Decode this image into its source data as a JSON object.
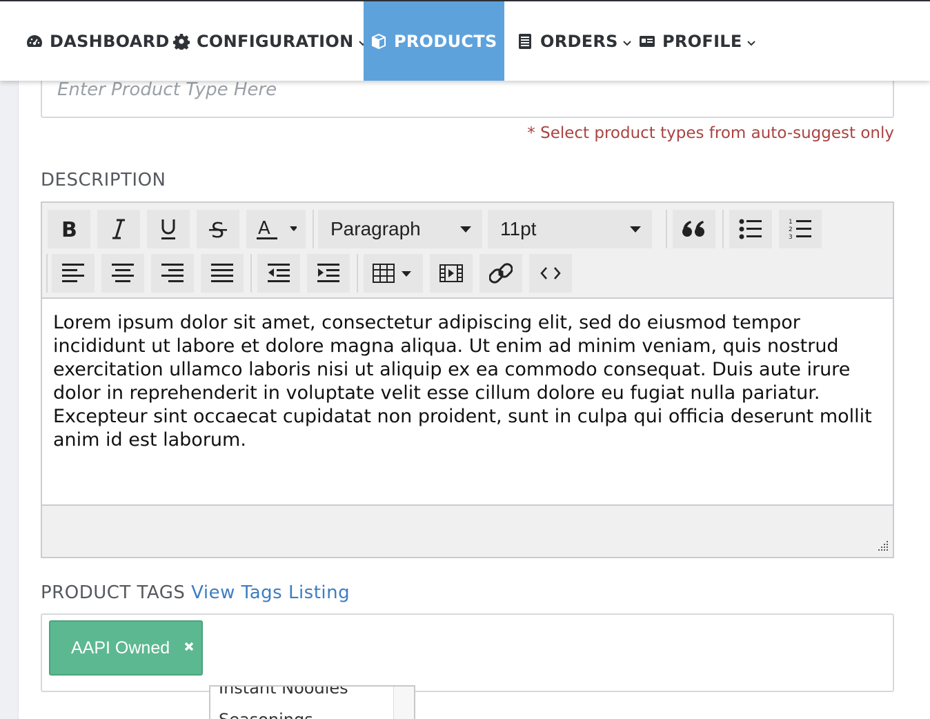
{
  "nav": {
    "items": [
      {
        "label": "DASHBOARD",
        "icon": "dashboard-icon",
        "dropdown": false
      },
      {
        "label": "CONFIGURATION",
        "icon": "gear-icon",
        "dropdown": true
      },
      {
        "label": "PRODUCTS",
        "icon": "box-icon",
        "dropdown": true,
        "active": true
      },
      {
        "label": "ORDERS",
        "icon": "list-icon",
        "dropdown": true
      },
      {
        "label": "PROFILE",
        "icon": "id-card-icon",
        "dropdown": true
      }
    ],
    "active_color": "#5ea2dc"
  },
  "product_type": {
    "placeholder": "Enter Product Type Here",
    "hint": "* Select product types from auto-suggest only"
  },
  "description": {
    "label": "DESCRIPTION",
    "toolbar": {
      "block_format": "Paragraph",
      "font_size": "11pt"
    },
    "text": "Lorem ipsum dolor sit amet, consectetur adipiscing elit, sed do eiusmod tempor incididunt ut labore et dolore magna aliqua. Ut enim ad minim veniam, quis nostrud exercitation ullamco laboris nisi ut aliquip ex ea commodo consequat. Duis aute irure dolor in reprehenderit in voluptate velit esse cillum dolore eu fugiat nulla pariatur. Excepteur sint occaecat cupidatat non proident, sunt in culpa qui officia deserunt mollit anim id est laborum."
  },
  "tags": {
    "label": "PRODUCT TAGS",
    "link": "View Tags Listing",
    "items": [
      "AAPI Owned"
    ],
    "tag_color": "#5cb891",
    "suggestions": [
      "Instant Noodles",
      "Seasonings"
    ]
  }
}
